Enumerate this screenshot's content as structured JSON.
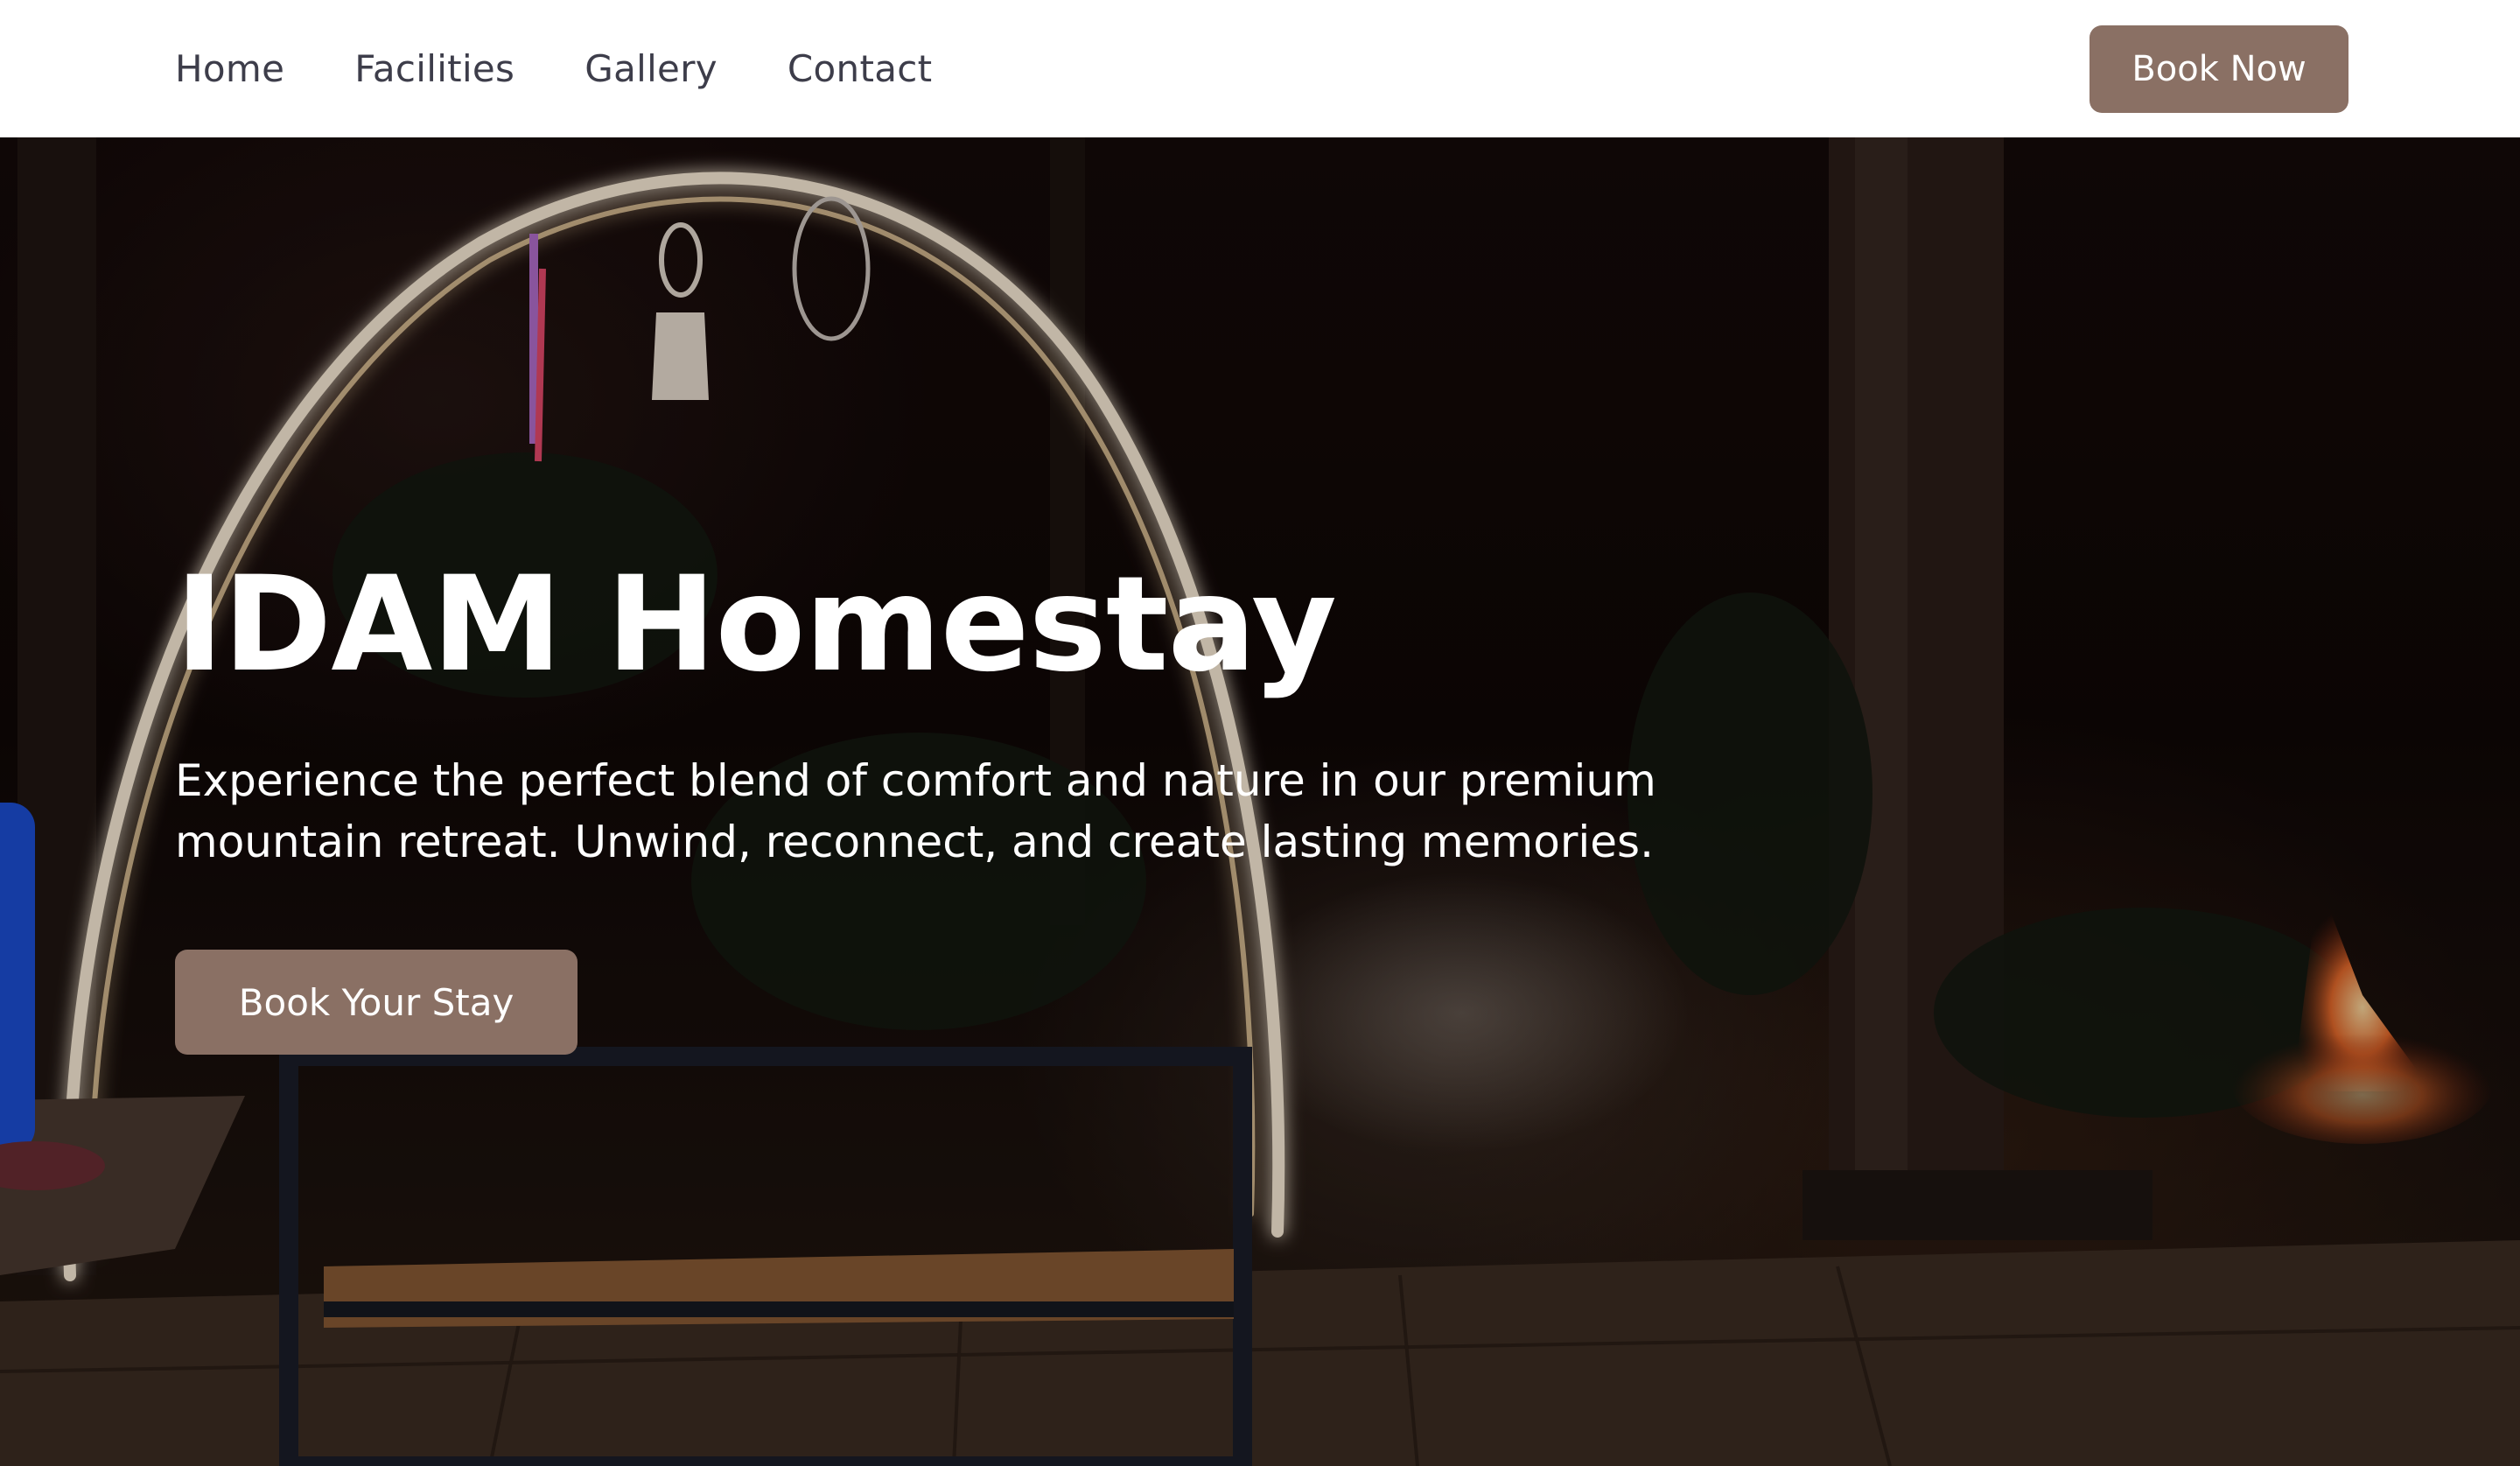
{
  "nav": {
    "links": [
      {
        "label": "Home"
      },
      {
        "label": "Facilities"
      },
      {
        "label": "Gallery"
      },
      {
        "label": "Contact"
      }
    ],
    "cta_label": "Book Now"
  },
  "hero": {
    "title": "IDAM Homestay",
    "subtitle": "Experience the perfect blend of comfort and nature in our premium mountain retreat. Unwind, reconnect, and create lasting memories.",
    "cta_label": "Book Your Stay"
  },
  "colors": {
    "accent": "#8a7064",
    "nav_text": "#3d3d4a",
    "nav_bg": "#ffffff",
    "hero_text": "#ffffff"
  }
}
